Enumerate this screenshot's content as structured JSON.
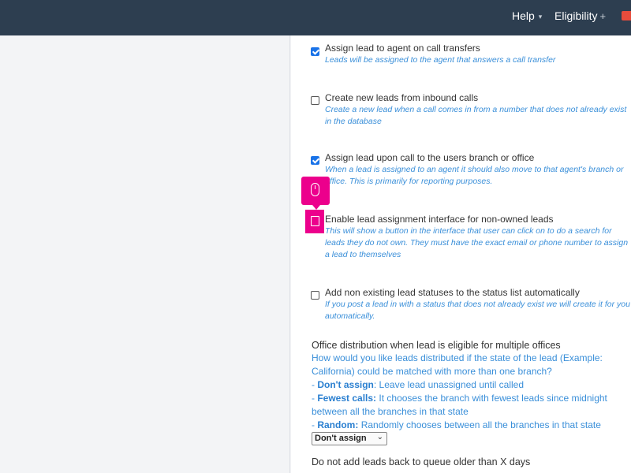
{
  "header": {
    "help_label": "Help",
    "eligibility_label": "Eligibility",
    "caret_glyph": "▾",
    "plus_glyph": "+",
    "alert_color": "#e74c3c"
  },
  "options": [
    {
      "title": "Assign lead to agent on call transfers",
      "description": "Leads will be assigned to the agent that answers a call transfer",
      "checked": true
    },
    {
      "title": "Create new leads from inbound calls",
      "description": "Create a new lead when a call comes in from a number that does not already exist in the database",
      "checked": false
    },
    {
      "title": "Assign lead upon call to the users branch or office",
      "description": "When a lead is assigned to an agent it should also move to that agent's branch or office. This is primarily for reporting purposes.",
      "checked": true
    },
    {
      "title": "Enable lead assignment interface for non-owned leads",
      "description": "This will show a button in the interface that user can click on to do a search for leads they do not own. They must have the exact email or phone number to assign a lead to themselves",
      "checked": false
    },
    {
      "title": "Add non existing lead statuses to the status list automatically",
      "description": "If you post a lead in with a status that does not already exist we will create it for you automatically.",
      "checked": false
    }
  ],
  "office_distribution": {
    "title": "Office distribution when lead is eligible for multiple offices",
    "question": "How would you like leads distributed if the state of the lead (Example: California) could be matched with more than one branch?",
    "choices": [
      {
        "label": "Don't assign",
        "text": "Leave lead unassigned until called"
      },
      {
        "label": "Fewest calls:",
        "text": "It chooses the branch with fewest leads since midnight between all the branches in that state"
      },
      {
        "label": "Random:",
        "text": "Randomly chooses between all the branches in that state"
      }
    ],
    "selected": "Don't assign"
  },
  "queue_age": {
    "title": "Do not add leads back to queue older than X days"
  },
  "highlight": {
    "color": "#ec008c",
    "icon": "mouse-icon"
  }
}
